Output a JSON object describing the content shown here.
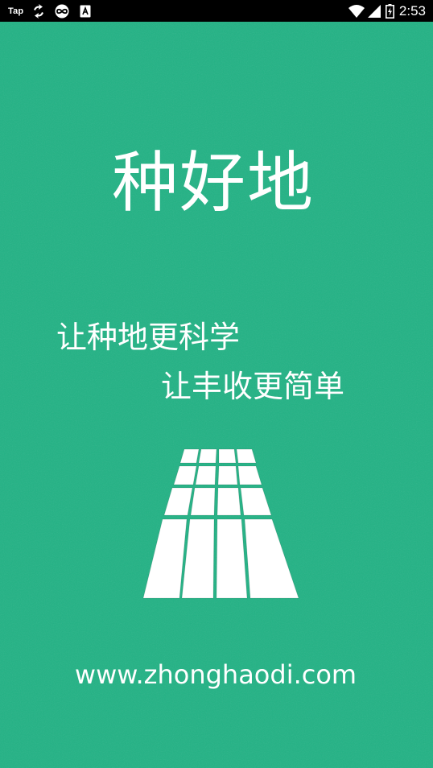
{
  "status_bar": {
    "app_label": "Tap",
    "time": "2:53",
    "icons": [
      "tap-app-icon",
      "sync-icon",
      "infinity-loop-icon",
      "text-a-icon",
      "wifi-icon",
      "cell-signal-icon",
      "battery-charging-icon"
    ]
  },
  "splash": {
    "title": "种好地",
    "slogan_line_1": "让种地更科学",
    "slogan_line_2": "让丰收更简单",
    "logo_icon": "farmland-rows-icon",
    "website": "www.zhonghaodi.com",
    "background_color": "#21b284",
    "text_color": "#ffffff"
  }
}
